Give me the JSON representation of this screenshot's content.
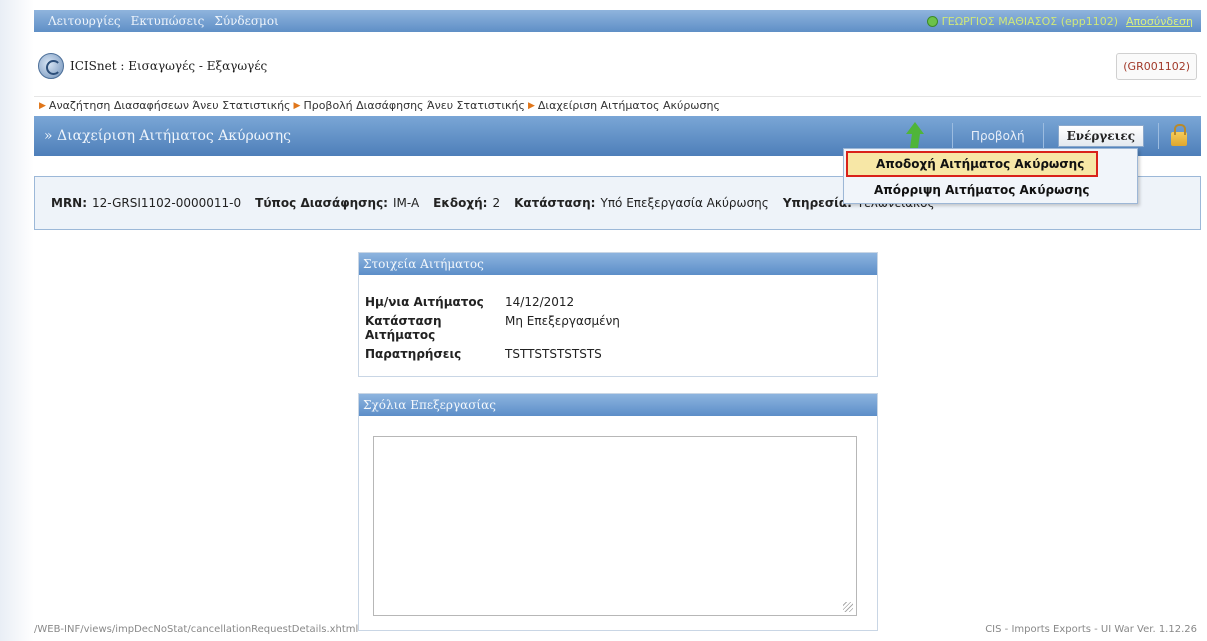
{
  "topbar": {
    "menu": [
      "Λειτουργίες",
      "Εκτυπώσεις",
      "Σύνδεσμοι"
    ],
    "user": "ΓΕΩΡΓΙΟΣ ΜΑΘΙΑΣΟΣ (epp1102)",
    "logout": "Αποσύνδεση"
  },
  "header": {
    "app_title": "ICISnet : Εισαγωγές - Εξαγωγές",
    "country_code": "(GR001102)"
  },
  "breadcrumb": [
    "Αναζήτηση Διασαφήσεων Άνευ Στατιστικής",
    "Προβολή Διασάφησης Άνευ Στατιστικής",
    "Διαχείριση Αιτήματος Ακύρωσης"
  ],
  "titlebar": {
    "title": "» Διαχείριση Αιτήματος Ακύρωσης",
    "view": "Προβολή",
    "actions": "Ενέργειες"
  },
  "dropdown": {
    "items": [
      "Αποδοχή Αιτήματος Ακύρωσης",
      "Απόρριψη Αιτήματος Ακύρωσης"
    ]
  },
  "info": {
    "mrn_label": "MRN:",
    "mrn": "12-GRSI1102-0000011-0",
    "type_label": "Τύπος Διασάφησης:",
    "type": "IM-A",
    "version_label": "Εκδοχή:",
    "version": "2",
    "status_label": "Κατάσταση:",
    "status": "Υπό Επεξεργασία Ακύρωσης",
    "branch_label": "Υπηρεσία:",
    "branch": "Τελωνειακός"
  },
  "details": {
    "header": "Στοιχεία Αιτήματος",
    "rows": [
      {
        "k": "Ημ/νια Αιτήματος",
        "v": "14/12/2012"
      },
      {
        "k": "Κατάσταση Αιτήματος",
        "v": "Μη Επεξεργασμένη"
      },
      {
        "k": "Παρατηρήσεις",
        "v": "TSTTSTSTSTSTS"
      }
    ]
  },
  "comments": {
    "header": "Σχόλια Επεξεργασίας",
    "value": ""
  },
  "footer": {
    "left": "/WEB-INF/views/impDecNoStat/cancellationRequestDetails.xhtml",
    "right": "CIS - Imports Exports - UI War Ver. 1.12.26"
  }
}
